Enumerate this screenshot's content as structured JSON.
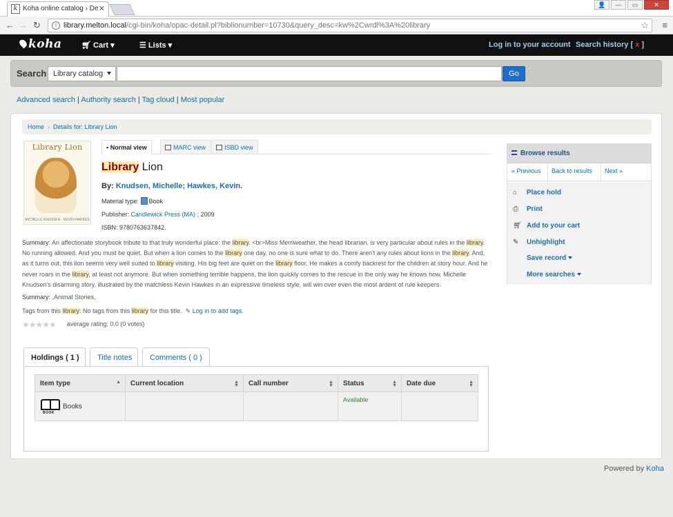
{
  "browser": {
    "tab_title": "Koha online catalog › De",
    "tab_favicon": "k",
    "url_host": "library.melton.local",
    "url_path": "/cgi-bin/koha/opac-detail.pl?biblionumber=10730&query_desc=kw%2Cwrdl%3A%20library"
  },
  "navbar": {
    "logo": "koha",
    "cart": "Cart",
    "lists": "Lists",
    "login": "Log in to your account",
    "search_history": "Search history",
    "history_clear": "x"
  },
  "search": {
    "label": "Search",
    "scope": "Library catalog",
    "go": "Go"
  },
  "more_searches": {
    "advanced": "Advanced search",
    "authority": "Authority search",
    "tag_cloud": "Tag cloud",
    "popular": "Most popular"
  },
  "breadcrumb": {
    "home": "Home",
    "details": "Details for: Library Lion"
  },
  "cover": {
    "title": "Library Lion",
    "credit": "MICHELLE KNUDSEN · KEVIN HAWKES"
  },
  "views": {
    "normal": "Normal view",
    "marc": "MARC view",
    "isbd": "ISBD view"
  },
  "record": {
    "title_hl": "Library",
    "title_rest": " Lion",
    "by_label": "By: ",
    "authors": "Knudsen, Michelle; Hawkes, Kevin.",
    "material_label": "Material type: ",
    "material": "Book",
    "publisher_label": "Publisher: ",
    "publisher": "Candlewick Press (MA)",
    "publisher_year": " ; 2009",
    "isbn_label": "ISBN: ",
    "isbn": "9780763637842.",
    "summary_label": "Summary: ",
    "summary_parts": [
      "An affectionate storybook tribute to that truly wonderful place: the ",
      "library",
      ". <br>Miss Merriweather, the head librarian, is very particular about rules in the ",
      "library",
      ". No running allowed. And you must be quiet. But when a lion comes to the ",
      "library",
      " one day, no one is sure what to do. There aren't any rules about lions in the ",
      "library",
      ". And, as it turns out, this lion seems very well suited to ",
      "library",
      " visiting. His big feet are quiet on the ",
      "library",
      " floor. He makes a comfy backrest for the children at story hour. And he never roars in the ",
      "library",
      ", at least not anymore. But when something terrible happens, the lion quickly comes to the rescue in the only way he knows how. Michelle Knudsen's disarming story, illustrated by the matchless Kevin Hawkes in an expressive timeless style, will win over even the most ardent of rule keepers."
    ],
    "summary2_label": "Summary: ",
    "summary2": ",Animal Stories,",
    "tags_label_a": "Tags from this ",
    "tags_label_hl": "library",
    "tags_label_b": ": No tags from this ",
    "tags_hl2": "library",
    "tags_rest": " for this title.",
    "login_tags": "Log in to add tags.",
    "rating_text": "average rating: 0.0 (0 votes)",
    "rating_value": 0
  },
  "holdings_tabs": {
    "holdings": "Holdings ( 1 )",
    "title_notes": "Title notes",
    "comments": "Comments ( 0 )"
  },
  "holdings_table": {
    "headers": [
      "Item type",
      "Current location",
      "Call number",
      "Status",
      "Date due"
    ],
    "rows": [
      {
        "item_type": "Books",
        "item_icon_label": "BOOK",
        "location": "",
        "call_number": "",
        "status": "Available",
        "date_due": ""
      }
    ]
  },
  "sidebar": {
    "browse": "Browse results",
    "previous": "« Previous",
    "back": "Back to results",
    "next": "Next »",
    "place_hold": "Place hold",
    "print": "Print",
    "add_cart": "Add to your cart",
    "unhighlight": "Unhighlight",
    "save_record": "Save record",
    "more_searches": "More searches"
  },
  "footer": {
    "powered_by": "Powered by ",
    "koha": "Koha"
  },
  "colors": {
    "navbar": "#111111",
    "link": "#0b6fa0",
    "go_button": "#1e6ec7",
    "highlight": "#fbeab4",
    "available": "#2a8a2a"
  }
}
